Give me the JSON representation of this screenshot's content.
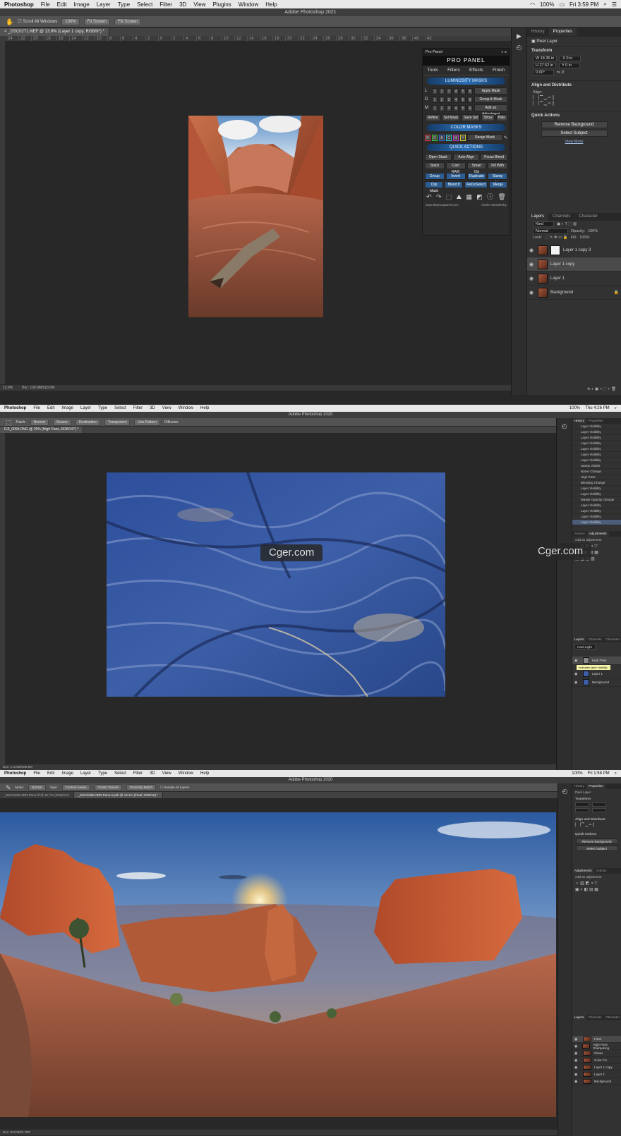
{
  "screen1": {
    "menubar": {
      "app": "Photoshop",
      "items": [
        "File",
        "Edit",
        "Image",
        "Layer",
        "Type",
        "Select",
        "Filter",
        "3D",
        "View",
        "Plugins",
        "Window",
        "Help"
      ],
      "battery": "100%",
      "clock": "Fri 3:59 PM"
    },
    "window_title": "Adobe Photoshop 2021",
    "options": {
      "scroll_all": "Scroll All Windows",
      "zoom": "100%",
      "fit": "Fit Screen",
      "fill": "Fill Screen"
    },
    "doc_tab": "_DSC0271.NEF @ 13.9% (Layer 1 copy, RGB/8*) *",
    "ruler_ticks": [
      "24",
      "22",
      "20",
      "18",
      "16",
      "14",
      "12",
      "10",
      "8",
      "6",
      "4",
      "2",
      "0",
      "2",
      "4",
      "6",
      "8",
      "10",
      "12",
      "14",
      "16",
      "18",
      "20",
      "22",
      "24",
      "26",
      "28",
      "30",
      "32",
      "34",
      "36",
      "38",
      "40",
      "42"
    ],
    "status": {
      "zoom": "13.9%",
      "doc": "Doc: 130.0M/520.0M"
    },
    "pro_panel": {
      "title": "Pro Panel",
      "logo": "PRO PANEL",
      "tabs": [
        "Tools",
        "Filters",
        "Effects",
        "Finish"
      ],
      "lum_header": "LUMINOSITY MASKS",
      "rows": [
        {
          "label": "L",
          "nums": [
            "1",
            "2",
            "3",
            "4",
            "5",
            "6"
          ],
          "action": "Apply Mask"
        },
        {
          "label": "D",
          "nums": [
            "1",
            "2",
            "3",
            "4",
            "5",
            "6"
          ],
          "action": "Group & Mask"
        },
        {
          "label": "M",
          "nums": [
            "1",
            "2",
            "3",
            "4",
            "5",
            "6"
          ],
          "action": "Add an Adjustment"
        }
      ],
      "mask_actions": [
        "Refine",
        "Sel Mask",
        "Save Sel",
        "Show",
        "Hide"
      ],
      "color_header": "COLOR MASKS",
      "color_letters": [
        "R",
        "G",
        "B",
        "C",
        "M",
        "Y"
      ],
      "range_mask": "Range Mask",
      "quick_header": "QUICK ACTIONS",
      "quick_row1": [
        "Open Stack",
        "Auto Align",
        "Focus Blend"
      ],
      "quick_row2": [
        "Stack",
        "Cam RAW",
        "Smart Obj",
        "Fill With"
      ],
      "quick_row3": [
        "Group",
        "Invert",
        "Duplicate",
        "Stamp Up"
      ],
      "quick_row4": [
        "Clip Mask",
        "Blend If",
        "ReDeSelect",
        "Merge"
      ],
      "footer_url": "www.theproapanel.com",
      "footer_author": "©John Weatherby"
    },
    "properties": {
      "tabs": [
        "History",
        "Properties"
      ],
      "kind": "Pixel Layer",
      "transform": "Transform",
      "w": "W 18.35 in",
      "h": "H 27.52 in",
      "x": "X 0 in",
      "y": "Y 0 in",
      "angle": "0.00°",
      "align_title": "Align and Distribute",
      "align": "Align:",
      "quick_title": "Quick Actions",
      "remove_bg": "Remove Background",
      "select_subject": "Select Subject",
      "view_more": "View More"
    },
    "layers_panel": {
      "tabs": [
        "Layers",
        "Channels",
        "Character"
      ],
      "kind": "Kind",
      "blend": "Normal",
      "opacity_label": "Opacity:",
      "opacity": "100%",
      "lock": "Lock:",
      "fill_label": "Fill:",
      "fill": "100%",
      "layers": [
        {
          "name": "Layer 1 copy 3",
          "selected": false,
          "mask": true
        },
        {
          "name": "Layer 1 copy",
          "selected": true,
          "mask": false
        },
        {
          "name": "Layer 1",
          "selected": false,
          "mask": false
        },
        {
          "name": "Background",
          "selected": false,
          "mask": false
        }
      ]
    }
  },
  "screen2": {
    "menubar": {
      "app": "Photoshop",
      "items": [
        "File",
        "Edit",
        "Image",
        "Layer",
        "Type",
        "Select",
        "Filter",
        "3D",
        "View",
        "Window",
        "Help"
      ],
      "battery": "100%",
      "clock": "Thu 4:26 PM"
    },
    "window_title": "Adobe Photoshop 2020",
    "options": {
      "patch": "Patch:",
      "mode": "Normal",
      "source": "Source",
      "destination": "Destination",
      "transparent": "Transparent",
      "use_pattern": "Use Pattern",
      "diffusion": "Diffusion:"
    },
    "doc_tab": "DJI_0094.DNG @ 25% (High Pass, RGB/16*) *",
    "watermark": "Cger.com",
    "status": "Doc: 172.8M/400.9M",
    "history_tabs": [
      "History",
      "Properties"
    ],
    "history": [
      "Layer Visibility",
      "Layer Visibility",
      "Layer Visibility",
      "Layer Visibility",
      "Layer Visibility",
      "Layer Visibility",
      "Layer Visibility",
      "Stamp Visible",
      "Name Change",
      "High Pass",
      "Blending Change",
      "Layer Visibility",
      "Layer Visibility",
      "Master Opacity Change",
      "Layer Visibility",
      "Layer Visibility",
      "Layer Visibility",
      "Layer Visibility"
    ],
    "adjust_tabs": [
      "Actions",
      "Adjustments"
    ],
    "adjust_hint": "Add an adjustment",
    "layers_tabs": [
      "Layers",
      "Channels",
      "Character"
    ],
    "layers_blend": "Hard Light",
    "layers": [
      {
        "name": "High Pass",
        "selected": true
      },
      {
        "name": "Layer 1",
        "selected": false
      },
      {
        "name": "Background",
        "selected": false
      }
    ],
    "tooltip": "Indicates layer visibility"
  },
  "screen3": {
    "menubar": {
      "app": "Photoshop",
      "items": [
        "File",
        "Edit",
        "Image",
        "Layer",
        "Type",
        "Select",
        "Filter",
        "3D",
        "View",
        "Window",
        "Help"
      ],
      "battery": "100%",
      "clock": "Fri 1:58 PM"
    },
    "window_title": "Adobe Photoshop 2020",
    "options": {
      "mode": "Mode:",
      "mode_val": "Normal",
      "type": "Type:",
      "content_aware": "Content-Aware",
      "create_texture": "Create Texture",
      "proximity": "Proximity Match",
      "sample": "Sample All Layers"
    },
    "tabs": [
      "_DSC2636-HDR-Pano.tif @ 16.7% (RGB/16*)",
      "_DSC2636-HDR-Pano-2.psb @ 13.1% (Final, RGB/16) *"
    ],
    "status": "Doc: 913.9M/2.78G",
    "props_tabs": [
      "History",
      "Properties"
    ],
    "props_kind": "Pixel Layer",
    "transform": "Transform",
    "align_title": "Align and Distribute",
    "quick_title": "Quick Actions",
    "remove_bg": "Remove Background",
    "select_subject": "Select Subject",
    "adjust_tabs": [
      "Adjustments",
      "Actions"
    ],
    "adjust_hint": "Add an adjustment",
    "layers_tabs": [
      "Layers",
      "Channels",
      "Character"
    ],
    "layers": [
      {
        "name": "Final",
        "selected": true
      },
      {
        "name": "High Pass Sharpening",
        "selected": false
      },
      {
        "name": "Glows",
        "selected": false
      },
      {
        "name": "Color Fix",
        "selected": false
      },
      {
        "name": "Layer 1 copy",
        "selected": false
      },
      {
        "name": "Layer 1",
        "selected": false
      },
      {
        "name": "Background",
        "selected": false
      }
    ]
  },
  "colors": {
    "accent_blue": "#2a6fb5",
    "panel_bg": "#323232",
    "canvas_bg": "#282828",
    "menubar_bg": "#e8e8e8"
  }
}
